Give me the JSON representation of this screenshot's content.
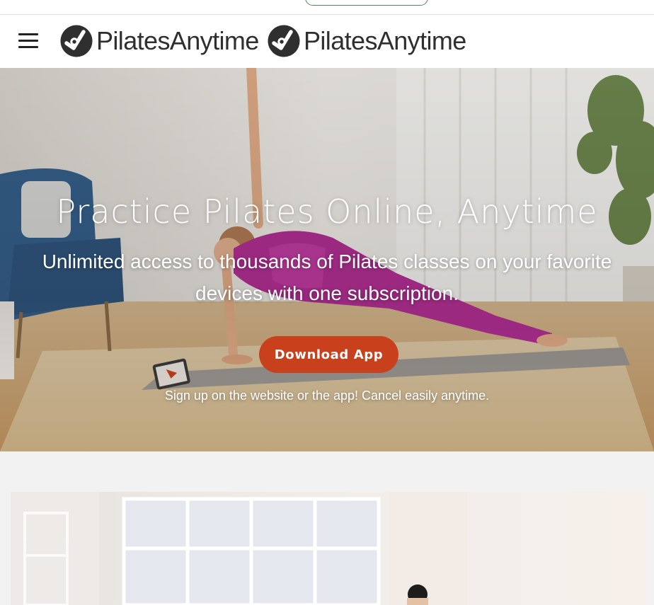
{
  "topbar": {
    "pill_label": ""
  },
  "nav": {
    "menu_icon": "hamburger-menu-icon",
    "logos": [
      {
        "icon": "pilates-anytime-logo-icon",
        "text": "PilatesAnytime"
      },
      {
        "icon": "pilates-anytime-logo-icon",
        "text": "PilatesAnytime"
      }
    ]
  },
  "hero": {
    "title": "Practice Pilates Online, Anytime",
    "subtitle": "Unlimited access to thousands of Pilates classes on your favorite devices with one subscription.",
    "cta_label": "Download App",
    "note": "Sign up on the website or the app! Cancel easily anytime."
  },
  "colors": {
    "cta": "#c8401c",
    "logo": "#2f2f2f",
    "pill_border": "#4a8a5a",
    "page_bg": "#f2f2f2"
  }
}
